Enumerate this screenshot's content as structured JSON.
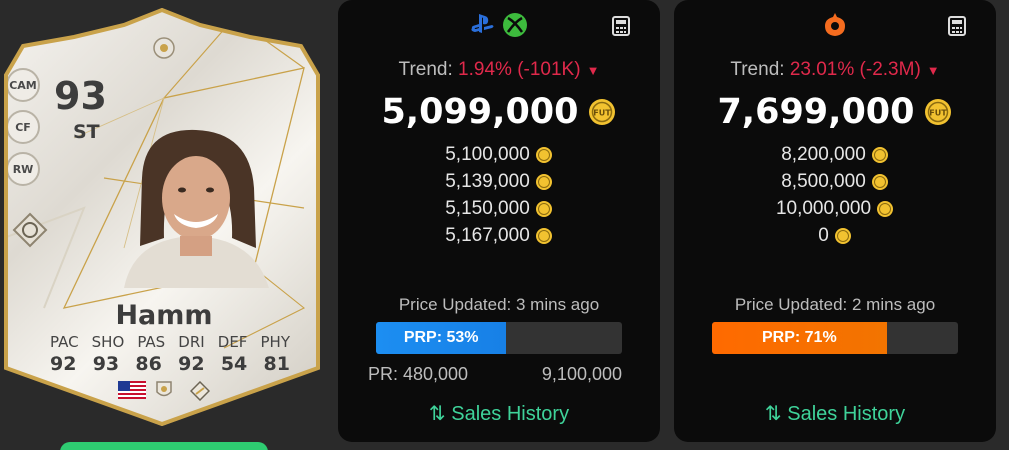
{
  "card": {
    "rating": "93",
    "position": "ST",
    "alt_positions": [
      "CAM",
      "CF",
      "RW"
    ],
    "name": "Hamm",
    "stat_labels": [
      "PAC",
      "SHO",
      "PAS",
      "DRI",
      "DEF",
      "PHY"
    ],
    "stat_values": [
      "92",
      "93",
      "86",
      "92",
      "54",
      "81"
    ],
    "nation_icon": "us-flag-icon",
    "club_icon": "icon-club-icon",
    "league_icon": "icon-league-icon"
  },
  "panels": [
    {
      "platform": "console",
      "platform_icons": [
        "playstation-icon",
        "xbox-icon"
      ],
      "trend_label": "Trend:",
      "trend_value": "1.94% (-101K)",
      "trend_color": "#e0294b",
      "main_price": "5,099,000",
      "prices": [
        "5,100,000",
        "5,139,000",
        "5,150,000",
        "5,167,000"
      ],
      "updated": "Price Updated: 3 mins ago",
      "prp_label": "PRP: 53%",
      "prp_percent": 53,
      "prp_color": "#1c8ef2",
      "pr_min": "PR: 480,000",
      "pr_max": "9,100,000",
      "sales_label": "Sales History"
    },
    {
      "platform": "pc",
      "platform_icons": [
        "origin-icon"
      ],
      "trend_label": "Trend:",
      "trend_value": "23.01% (-2.3M)",
      "trend_color": "#e0294b",
      "main_price": "7,699,000",
      "prices": [
        "8,200,000",
        "8,500,000",
        "10,000,000",
        "0"
      ],
      "updated": "Price Updated: 2 mins ago",
      "prp_label": "PRP: 71%",
      "prp_percent": 71,
      "prp_color": "#ff6a00",
      "sales_label": "Sales History"
    }
  ]
}
